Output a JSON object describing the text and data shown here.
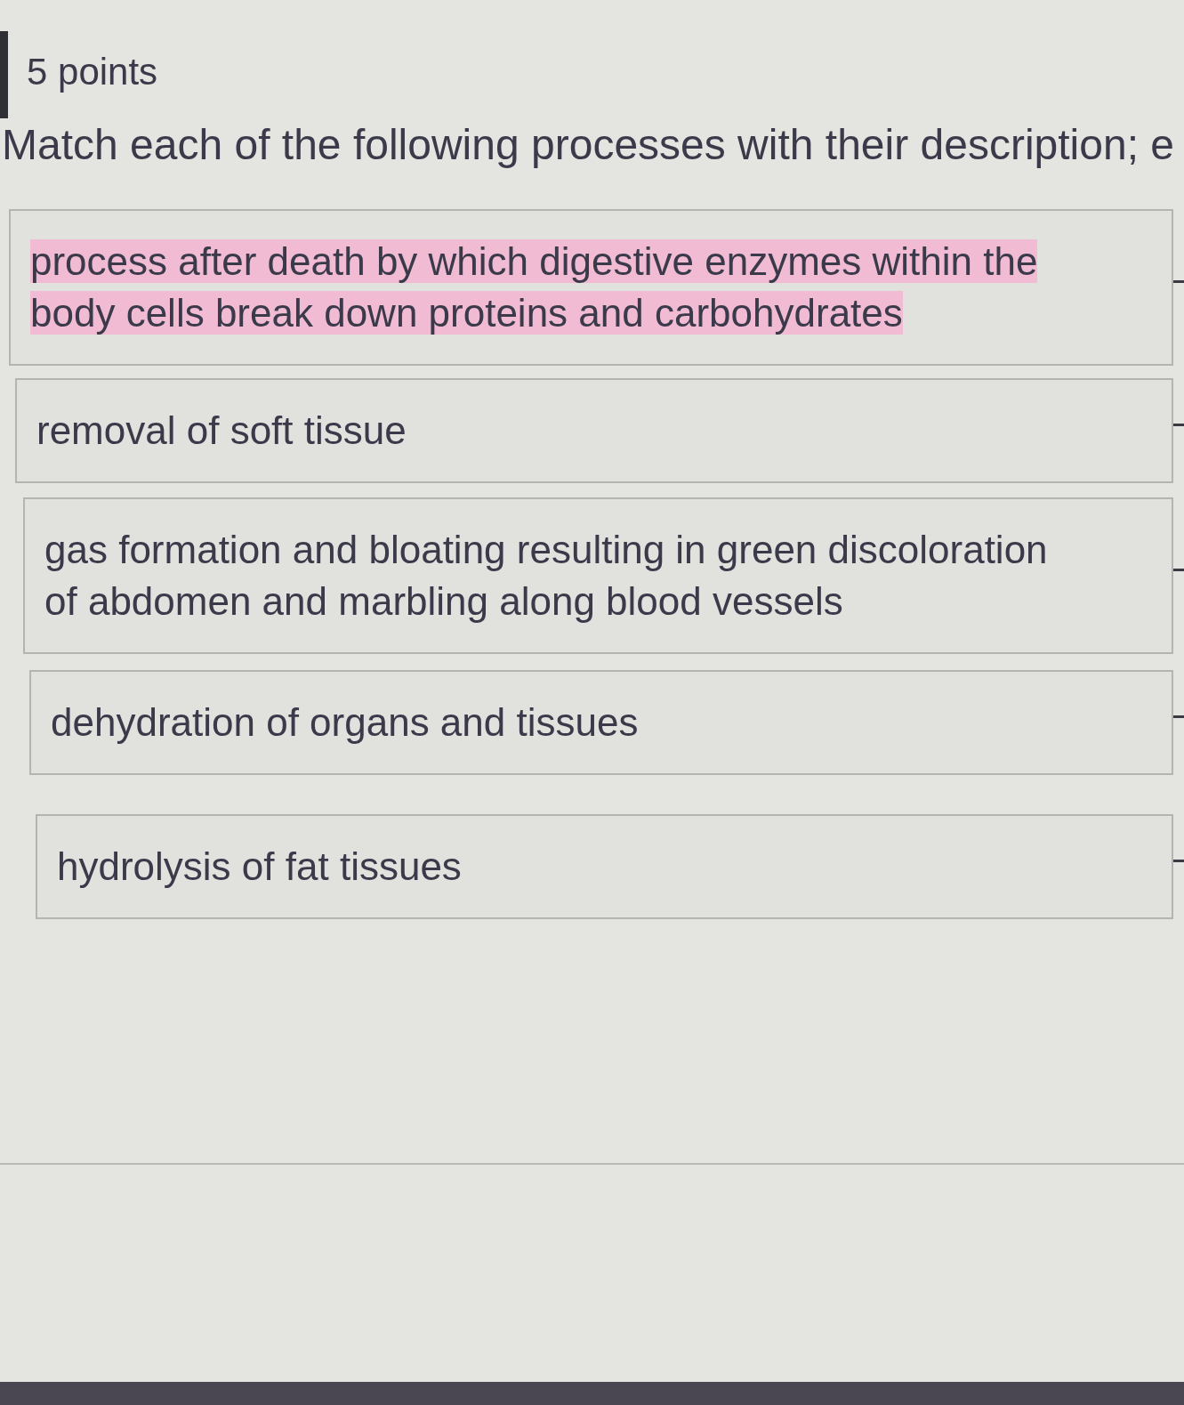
{
  "question": {
    "points": "5 points",
    "prompt": "Match each of the following processes with their description; e"
  },
  "descriptions": [
    {
      "text": "process after death by which digestive enzymes within the body cells break down proteins and carbohydrates",
      "highlighted": true
    },
    {
      "text": "removal of soft tissue",
      "highlighted": false
    },
    {
      "text": "gas formation and bloating resulting in green discoloration of abdomen and marbling along blood vessels",
      "highlighted": false
    },
    {
      "text": "dehydration of organs and tissues",
      "highlighted": false
    },
    {
      "text": "hydrolysis of fat tissues",
      "highlighted": false
    }
  ]
}
